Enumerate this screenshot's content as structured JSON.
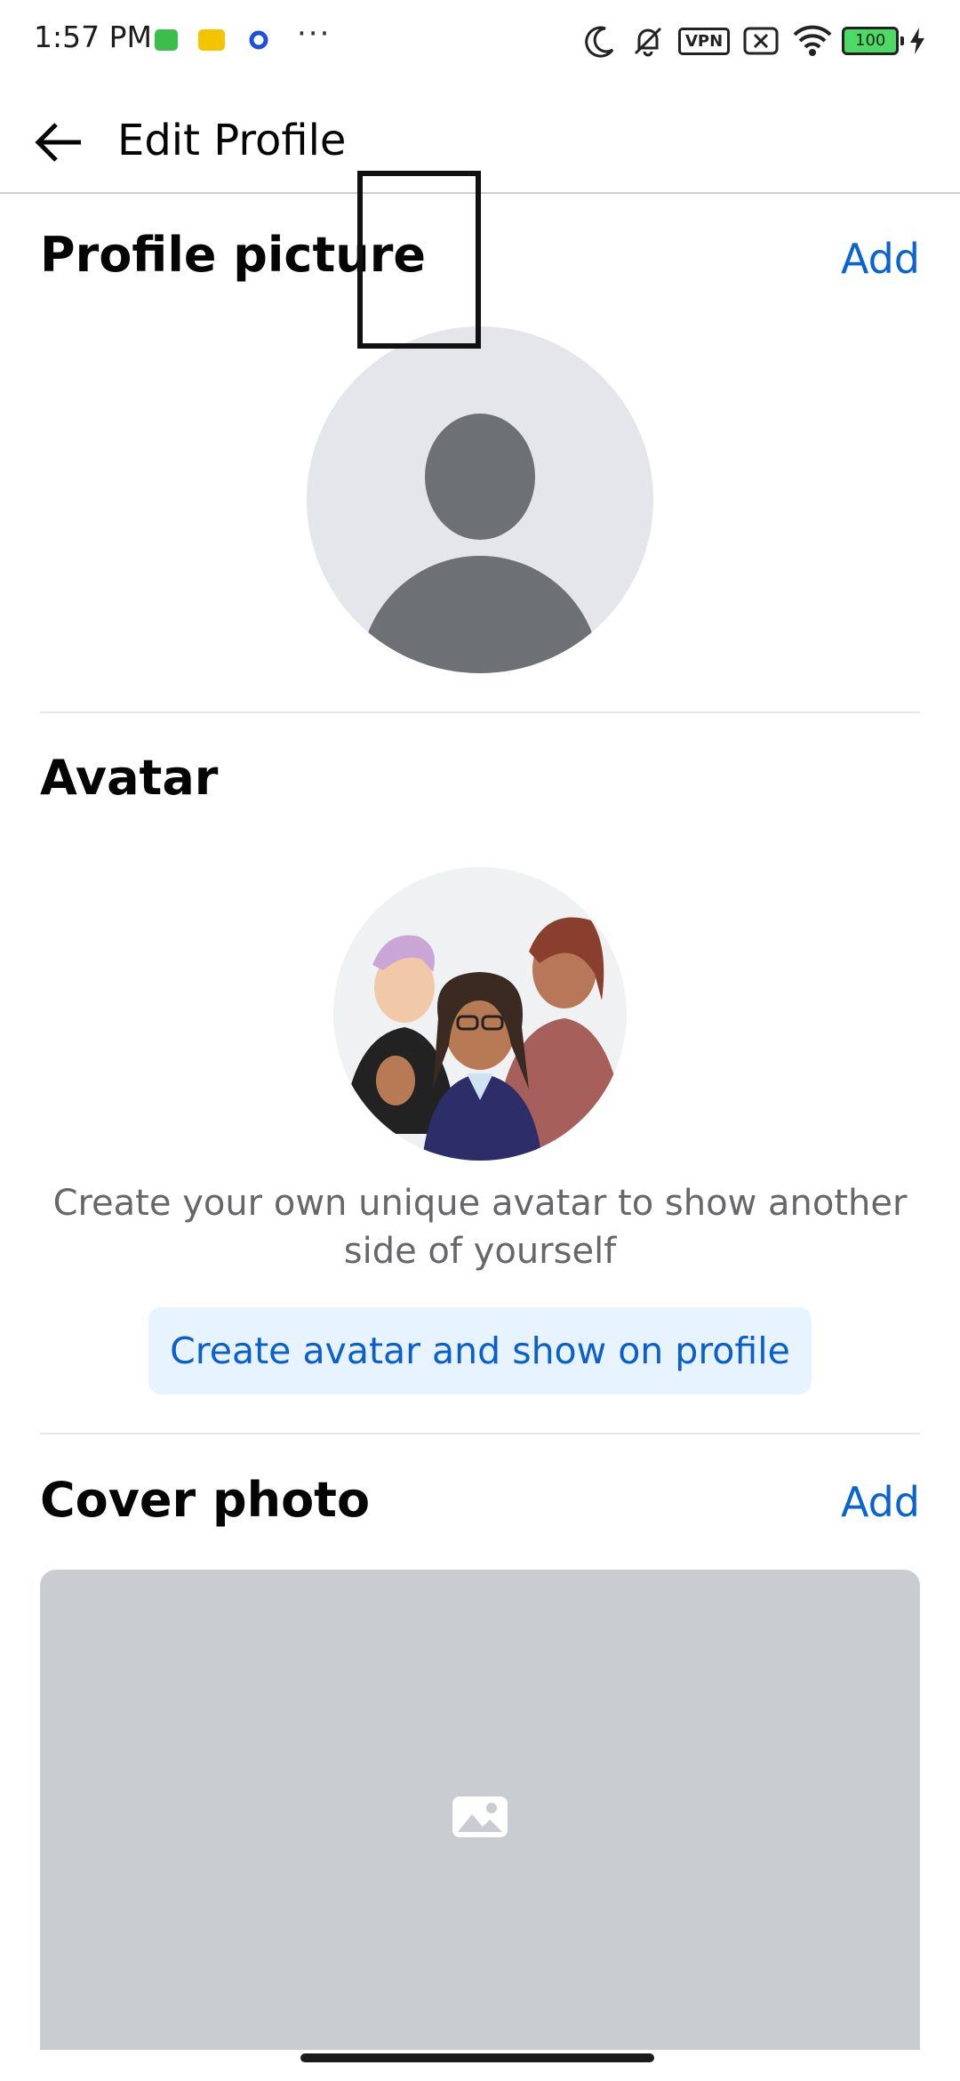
{
  "status_bar": {
    "time": "1:57 PM",
    "overflow": "···",
    "vpn_label": "VPN",
    "battery": "100",
    "icons": [
      "moon-icon",
      "bell-muted-icon",
      "vpn-icon",
      "no-sim-icon",
      "wifi-icon",
      "battery-icon",
      "charging-icon"
    ]
  },
  "header": {
    "title": "Edit Profile",
    "back_icon": "arrow-left-icon"
  },
  "profile_picture": {
    "title": "Profile picture",
    "add_label": "Add"
  },
  "avatar": {
    "title": "Avatar",
    "description": "Create your own unique avatar to show another side of yourself",
    "button_label": "Create avatar and show on profile"
  },
  "cover_photo": {
    "title": "Cover photo",
    "add_label": "Add",
    "placeholder_icon": "image-icon"
  },
  "colors": {
    "accent": "#0a64d0",
    "button_bg": "#e7f3ff",
    "placeholder": "#c9ccd1"
  }
}
